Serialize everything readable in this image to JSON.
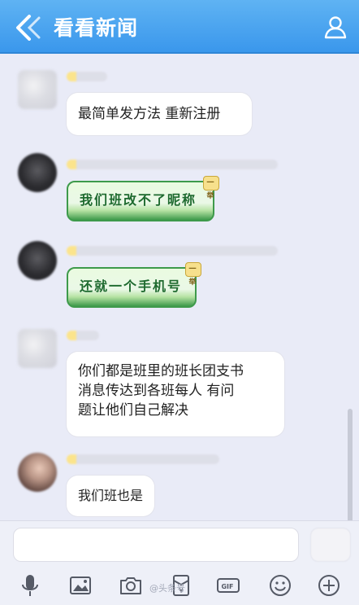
{
  "header": {
    "title": "看看新闻",
    "back_icon": "back-chevron-icon",
    "profile_icon": "person-icon",
    "accent": "#3a97ec"
  },
  "messages": [
    {
      "type": "text",
      "text": "最简单发方法 重新注册"
    },
    {
      "type": "sticker",
      "text": "我们班改不了昵称",
      "badge": "一举"
    },
    {
      "type": "sticker",
      "text": "还就一个手机号",
      "badge": "一举"
    },
    {
      "type": "text",
      "text": "你们都是班里的班长团支书\n消息传达到各班每人 有问\n题让他们自己解决"
    },
    {
      "type": "handwriting",
      "text": "我们班也是"
    }
  ],
  "toolbar": {
    "icons": [
      "microphone-icon",
      "image-icon",
      "camera-icon",
      "red-packet-icon",
      "gif-icon",
      "emoji-icon",
      "plus-icon"
    ]
  },
  "watermark": "@头条号"
}
